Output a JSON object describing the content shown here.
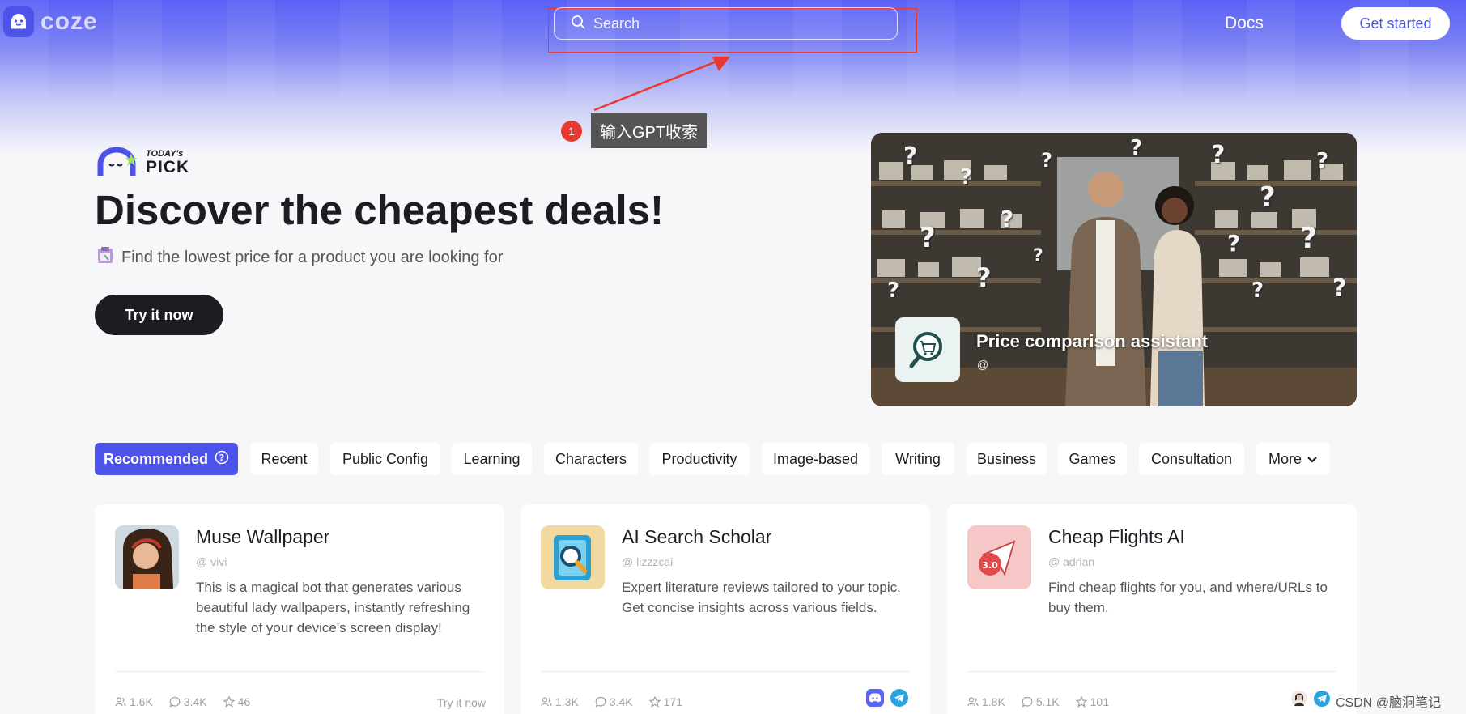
{
  "header": {
    "logo_text": "coze",
    "search_placeholder": "Search",
    "docs_label": "Docs",
    "get_started_label": "Get started"
  },
  "annotation": {
    "number": "1",
    "tooltip": "输入GPT收索"
  },
  "hero": {
    "badge_small": "TODAY's",
    "badge_big": "PICK",
    "title": "Discover the cheapest deals!",
    "subtitle": "Find the lowest price for a product you are looking for",
    "cta_label": "Try it now",
    "featured": {
      "title": "Price comparison assistant",
      "author": "@"
    }
  },
  "tabs": [
    {
      "label": "Recommended"
    },
    {
      "label": "Recent"
    },
    {
      "label": "Public Config"
    },
    {
      "label": "Learning"
    },
    {
      "label": "Characters"
    },
    {
      "label": "Productivity"
    },
    {
      "label": "Image-based"
    },
    {
      "label": "Writing"
    },
    {
      "label": "Business"
    },
    {
      "label": "Games"
    },
    {
      "label": "Consultation"
    },
    {
      "label": "More"
    }
  ],
  "cards": [
    {
      "title": "Muse Wallpaper",
      "author": "vivi",
      "description": "This is a magical bot that generates various beautiful lady wallpapers, instantly refreshing the style of your device's screen display!",
      "users": "1.6K",
      "messages": "3.4K",
      "stars": "46",
      "action": "Try it now"
    },
    {
      "title": "AI Search Scholar",
      "author": "lizzzcai",
      "description": "Expert literature reviews tailored to your topic. Get concise insights across various fields.",
      "users": "1.3K",
      "messages": "3.4K",
      "stars": "171"
    },
    {
      "title": "Cheap Flights AI",
      "author": "adrian",
      "description": "Find cheap flights for you, and where/URLs to buy them.",
      "users": "1.8K",
      "messages": "5.1K",
      "stars": "101"
    }
  ],
  "watermark": "CSDN @脑洞笔记",
  "colors": {
    "accent": "#4d53e8",
    "dark": "#1c1d23",
    "annotation_red": "#e8392f"
  }
}
